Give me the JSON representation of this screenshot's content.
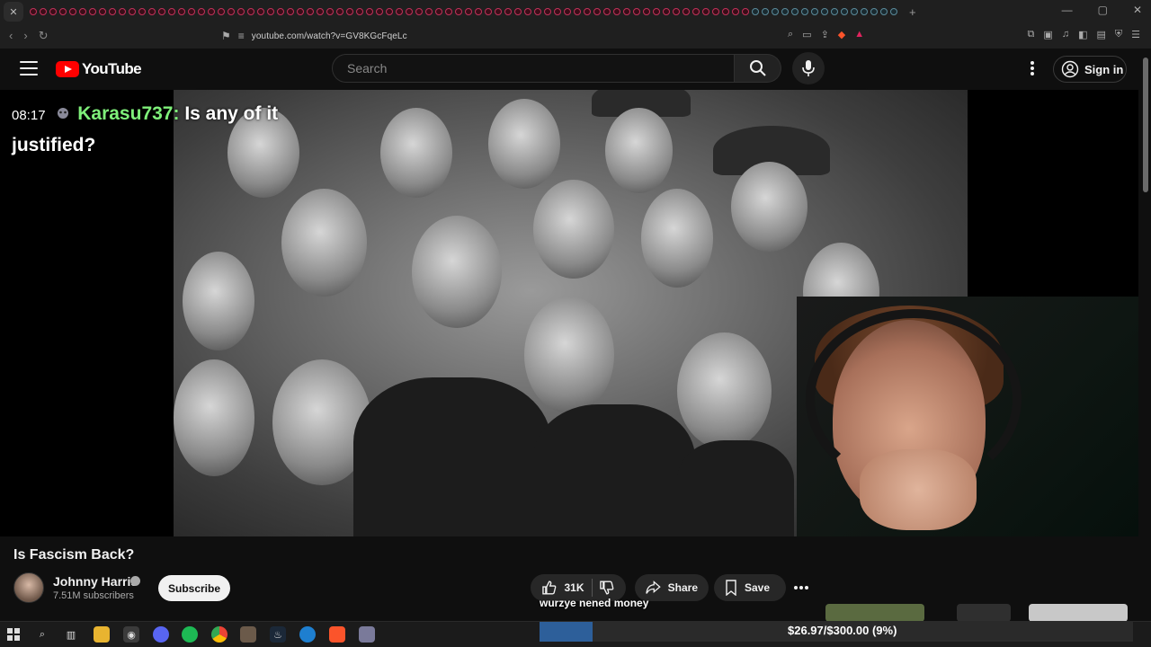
{
  "browser": {
    "url": "youtube.com/watch?v=GV8KGcFqeLc"
  },
  "header": {
    "logo_text": "YouTube",
    "search_placeholder": "Search",
    "sign_in_label": "Sign in"
  },
  "chat": {
    "time": "08:17",
    "username": "Karasu737:",
    "message": "Is any of it justified?"
  },
  "video": {
    "title": "Is Fascism Back?",
    "channel_name": "Johnny Harris",
    "subscribers": "7.51M subscribers",
    "subscribe_label": "Subscribe",
    "like_count": "31K",
    "share_label": "Share",
    "save_label": "Save"
  },
  "overlay": {
    "caption": "wurzye nened money",
    "donation_text": "$26.97/$300.00 (9%)",
    "donation_fraction": 0.09
  },
  "colors": {
    "youtube_red": "#ff0000",
    "chat_username": "#7ff07a",
    "background": "#0f0f0f",
    "donation_fill": "#2d5f9a"
  },
  "icons": {
    "menu": "hamburger-icon",
    "search": "search-icon",
    "mic": "mic-icon",
    "more": "more-vert-icon",
    "account": "account-icon",
    "like": "thumbs-up-icon",
    "dislike": "thumbs-down-icon",
    "share": "share-arrow-icon",
    "save": "bookmark-icon"
  }
}
